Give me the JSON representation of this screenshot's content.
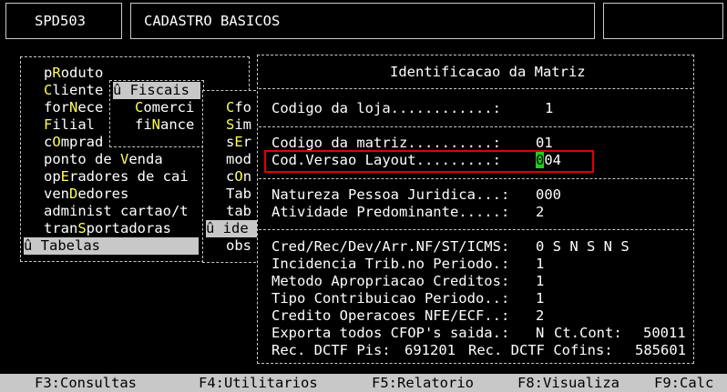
{
  "header": {
    "program_code": "SPD503",
    "screen_title": "CADASTRO BASICOS"
  },
  "menu_main": {
    "items": [
      {
        "pre": "p",
        "hot": "R",
        "post": "oduto"
      },
      {
        "pre": "",
        "hot": "C",
        "post": "liente"
      },
      {
        "pre": "for",
        "hot": "N",
        "post": "ece"
      },
      {
        "pre": "",
        "hot": "F",
        "post": "ilial"
      },
      {
        "pre": "c",
        "hot": "O",
        "post": "mprad"
      },
      {
        "pre": "ponto de ",
        "hot": "V",
        "post": "enda"
      },
      {
        "pre": "op",
        "hot": "E",
        "post": "radores de cai"
      },
      {
        "pre": "ven",
        "hot": "D",
        "post": "edores"
      },
      {
        "pre": "administ cartao/t",
        "hot": "",
        "post": ""
      },
      {
        "pre": "tran",
        "hot": "S",
        "post": "portadoras"
      }
    ],
    "selected": "û Tabelas"
  },
  "menu_cliente": {
    "header": "û Fiscais",
    "items": [
      {
        "pre": "",
        "hot": "C",
        "post": "omerci"
      },
      {
        "pre": "fi",
        "hot": "N",
        "post": "ance"
      }
    ]
  },
  "menu_fiscais": {
    "items": [
      {
        "pre": "",
        "hot": "C",
        "post": "fo"
      },
      {
        "pre": "",
        "hot": "S",
        "post": "im"
      },
      {
        "pre": "s",
        "hot": "E",
        "post": "r"
      },
      {
        "pre": "mod",
        "hot": "",
        "post": ""
      },
      {
        "pre": "c",
        "hot": "O",
        "post": "n"
      },
      {
        "pre": "Tab",
        "hot": "",
        "post": ""
      },
      {
        "pre": "tab",
        "hot": "",
        "post": ""
      }
    ],
    "selected": "û ide",
    "after": "obs"
  },
  "dialog": {
    "title": "Identificacao da Matriz",
    "codigo_loja_label": "Codigo da loja............:",
    "codigo_loja_value": "1",
    "codigo_matriz_label": "Codigo da matriz..........:",
    "codigo_matriz_value": "01",
    "versao_layout_label": "Cod.Versao Layout.........:",
    "versao_layout_cursor": "0",
    "versao_layout_rest": "04",
    "natureza_label": "Natureza Pessoa Juridica...:",
    "natureza_value": "000",
    "atividade_label": "Atividade Predominante.....:",
    "atividade_value": "2",
    "cred_label": "Cred/Rec/Dev/Arr.NF/ST/ICMS:",
    "cred_value": "0 S N S N S",
    "incidencia_label": "Incidencia Trib.no Periodo.:",
    "incidencia_value": "1",
    "metodo_label": "Metodo Apropriacao Creditos:",
    "metodo_value": "1",
    "tipo_contrib_label": "Tipo Contribuicao Periodo..:",
    "tipo_contrib_value": "1",
    "credito_nfe_label": "Credito Operacoes NFE/ECF..:",
    "credito_nfe_value": "2",
    "exporta_label": "Exporta todos CFOP's saida.:",
    "exporta_value": "N",
    "ct_cont_label": "Ct.Cont:",
    "ct_cont_value": "50011",
    "dctf_pis_label": "Rec. DCTF Pis:",
    "dctf_pis_value": "691201",
    "dctf_cofins_label": "Rec. DCTF Cofins:",
    "dctf_cofins_value": "585601"
  },
  "function_keys": [
    "F3:Consultas",
    "F4:Utilitarios",
    "F5:Relatorio",
    "F8:Visualiza",
    "F9:Calc"
  ]
}
